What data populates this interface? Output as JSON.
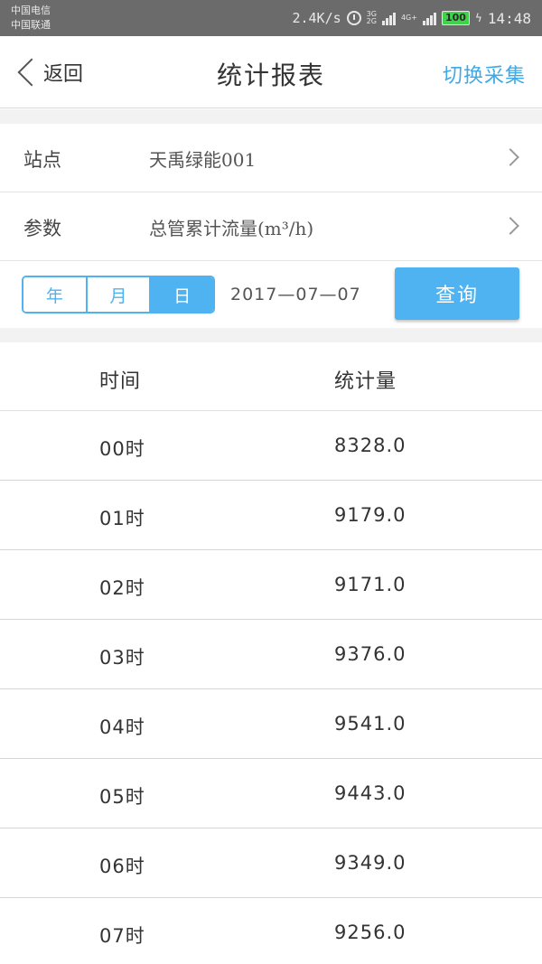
{
  "status_bar": {
    "carrier_1": "中国电信",
    "carrier_2": "中国联通",
    "net_speed": "2.4K/s",
    "sig1_label_top": "3G",
    "sig1_label_bottom": "2G",
    "sig2_label": "4G+",
    "battery": "100",
    "time": "14:48"
  },
  "nav": {
    "back_label": "返回",
    "title": "统计报表",
    "switch_label": "切换采集"
  },
  "form": {
    "station_label": "站点",
    "station_value": "天禹绿能001",
    "param_label": "参数",
    "param_value": "总管累计流量(m³/h)"
  },
  "date_filter": {
    "year_label": "年",
    "month_label": "月",
    "day_label": "日",
    "selected": "日",
    "date": "2017—07—07",
    "query_label": "查询"
  },
  "table": {
    "headers": {
      "time": "时间",
      "value": "统计量"
    },
    "rows": [
      {
        "time": "00时",
        "value": "8328.0"
      },
      {
        "time": "01时",
        "value": "9179.0"
      },
      {
        "time": "02时",
        "value": "9171.0"
      },
      {
        "time": "03时",
        "value": "9376.0"
      },
      {
        "time": "04时",
        "value": "9541.0"
      },
      {
        "time": "05时",
        "value": "9443.0"
      },
      {
        "time": "06时",
        "value": "9349.0"
      },
      {
        "time": "07时",
        "value": "9256.0"
      }
    ]
  },
  "colors": {
    "accent": "#4eb3f0",
    "link": "#3fa9e6",
    "status_bar_bg": "#6b6b6b",
    "battery": "#3fd34b"
  }
}
